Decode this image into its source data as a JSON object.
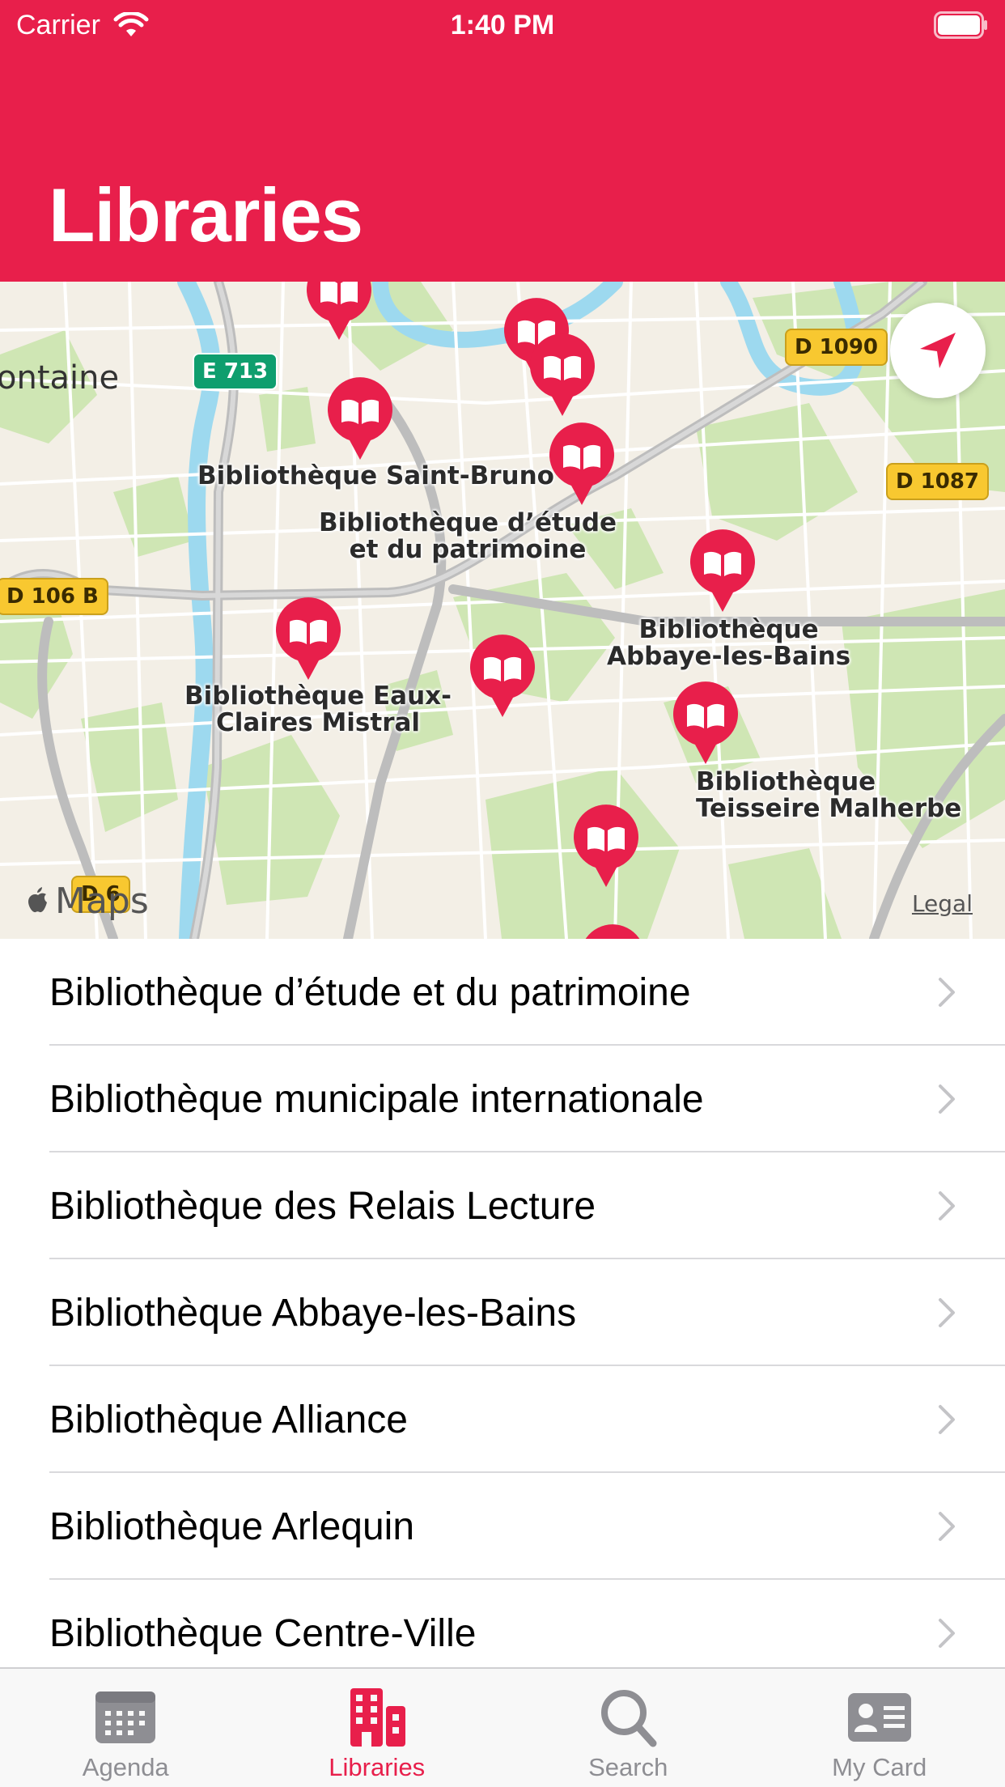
{
  "status_bar": {
    "carrier": "Carrier",
    "time": "1:40 PM"
  },
  "header": {
    "title": "Libraries"
  },
  "map": {
    "place_name": "ontaine",
    "roads": [
      "D 1090",
      "D 1087",
      "D 106 B",
      "E 713",
      "D 6"
    ],
    "pins": [
      {
        "label": "Bibliothèque Saint-Bruno"
      },
      {
        "label": "Bibliothèque d’étude\net du patrimoine"
      },
      {
        "label": "Bibliothèque\nAbbaye-les-Bains"
      },
      {
        "label": "Bibliothèque Eaux-\nClaires Mistral"
      },
      {
        "label": "Bibliothèque\nTeisseire Malherbe"
      }
    ],
    "maps_label": "Maps",
    "legal": "Legal",
    "pin_color": "#e81f4b"
  },
  "libraries": [
    "Bibliothèque d’étude et du patrimoine",
    "Bibliothèque municipale internationale",
    "Bibliothèque des Relais Lecture",
    "Bibliothèque Abbaye-les-Bains",
    "Bibliothèque Alliance",
    "Bibliothèque Arlequin",
    "Bibliothèque Centre-Ville"
  ],
  "tabs": [
    {
      "label": "Agenda",
      "icon": "calendar-icon",
      "active": false
    },
    {
      "label": "Libraries",
      "icon": "buildings-icon",
      "active": true
    },
    {
      "label": "Search",
      "icon": "search-icon",
      "active": false
    },
    {
      "label": "My Card",
      "icon": "id-card-icon",
      "active": false
    }
  ],
  "colors": {
    "brand": "#e81f4b",
    "inactive_tab": "#8e8e93"
  }
}
